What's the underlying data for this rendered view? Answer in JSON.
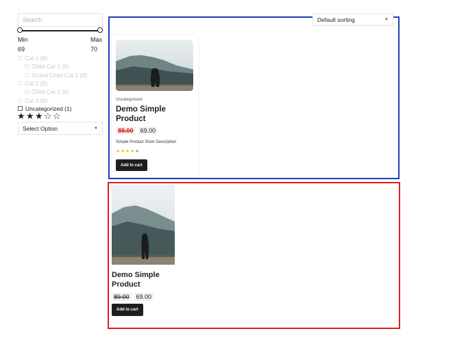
{
  "sidebar": {
    "search": {
      "placeholder": "Search",
      "value": ""
    },
    "price_filter": {
      "min_label": "Min",
      "max_label": "Max",
      "min_value": "69",
      "max_value": "70"
    },
    "categories": [
      {
        "label": "Cat 1 (0)",
        "level": 0,
        "active": false
      },
      {
        "label": "Child Cat 1 (0)",
        "level": 1,
        "active": false
      },
      {
        "label": "Grand Child Cat 1 (0)",
        "level": 2,
        "active": false
      },
      {
        "label": "Cat 2 (0)",
        "level": 0,
        "active": false
      },
      {
        "label": "Child Cat 2 (0)",
        "level": 1,
        "active": false
      },
      {
        "label": "Cat 3 (0)",
        "level": 0,
        "active": false
      },
      {
        "label": "Uncategorized (1)",
        "level": 0,
        "active": true
      }
    ],
    "rating_filter": {
      "value": 3,
      "max": 5
    },
    "select": {
      "label": "Select Option"
    }
  },
  "sorting": {
    "label": "Default sorting"
  },
  "products": [
    {
      "category": "Uncategorized",
      "title": "Demo Simple Product",
      "old_price": "89.00",
      "new_price": "69.00",
      "short_description": "Simple Product Short Description",
      "rating": 4,
      "rating_max": 5,
      "button": "Add to cart"
    },
    {
      "title": "Demo Simple Product",
      "old_price": "89.00",
      "new_price": "69.00",
      "button": "Add to cart"
    }
  ],
  "colors": {
    "accent": "#1e1e1e",
    "sale_price": "#e21b1b",
    "star": "#f2c51a",
    "box_blue": "#1a3fbf",
    "box_red": "#e21b1b"
  },
  "icons": {
    "dropdown": "chevron-down-icon",
    "star": "star-icon",
    "checkbox": "checkbox-icon"
  }
}
